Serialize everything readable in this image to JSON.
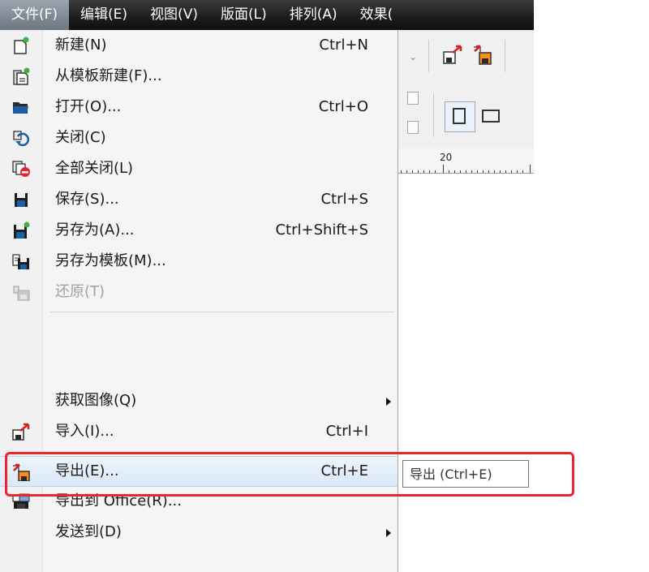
{
  "menubar": {
    "items": [
      "文件(F)",
      "编辑(E)",
      "视图(V)",
      "版面(L)",
      "排列(A)",
      "效果("
    ]
  },
  "file_menu": {
    "items": [
      {
        "label": "新建(N)",
        "shortcut": "Ctrl+N",
        "icon": "new-document-icon"
      },
      {
        "label": "从模板新建(F)...",
        "shortcut": "",
        "icon": "new-from-template-icon"
      },
      {
        "label": "打开(O)...",
        "shortcut": "Ctrl+O",
        "icon": "open-folder-icon"
      },
      {
        "label": "关闭(C)",
        "shortcut": "",
        "icon": "close-document-icon"
      },
      {
        "label": "全部关闭(L)",
        "shortcut": "",
        "icon": "close-all-icon"
      },
      {
        "label": "保存(S)...",
        "shortcut": "Ctrl+S",
        "icon": "save-icon"
      },
      {
        "label": "另存为(A)...",
        "shortcut": "Ctrl+Shift+S",
        "icon": "save-as-icon"
      },
      {
        "label": "另存为模板(M)...",
        "shortcut": "",
        "icon": "save-as-template-icon"
      },
      {
        "label": "还原(T)",
        "shortcut": "",
        "icon": "revert-icon",
        "disabled": true
      },
      {
        "label": "获取图像(Q)",
        "shortcut": "",
        "submenu": true
      },
      {
        "label": "导入(I)...",
        "shortcut": "Ctrl+I",
        "icon": "import-icon"
      },
      {
        "label": "导出(E)...",
        "shortcut": "Ctrl+E",
        "icon": "export-icon",
        "highlighted": true
      },
      {
        "label": "导出到 Office(R)...",
        "shortcut": "",
        "icon": "export-office-icon"
      },
      {
        "label": "发送到(D)",
        "shortcut": "",
        "submenu": true
      }
    ]
  },
  "tooltip": {
    "text": "导出 (Ctrl+E)"
  },
  "ruler": {
    "label": "20"
  },
  "colors": {
    "highlight_border": "#e8262b",
    "menu_highlight": "#d9e8f8",
    "menubar_bg": "#1e1e1e"
  }
}
